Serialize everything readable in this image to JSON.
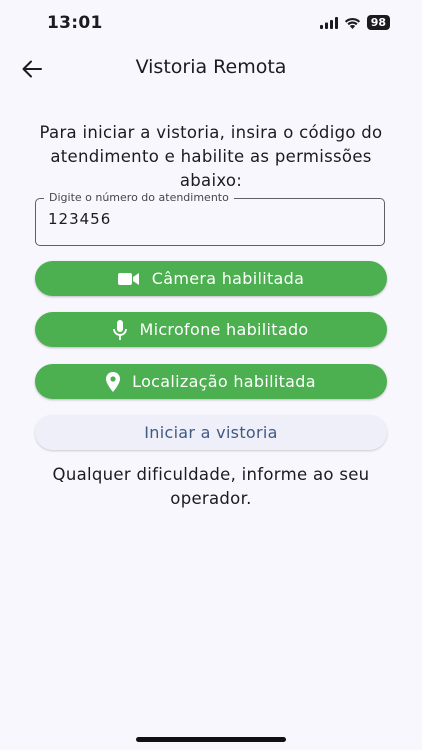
{
  "status_bar": {
    "time": "13:01",
    "battery": "98"
  },
  "app_bar": {
    "title": "Vistoria Remota"
  },
  "intro_text": "Para iniciar a vistoria, insira o código do atendimento e habilite as permissões abaixo:",
  "attendance_field": {
    "label": "Digite o número do atendimento",
    "value": "123456"
  },
  "permissions": {
    "camera": "Câmera habilitada",
    "microphone": "Microfone habilitado",
    "location": "Localização habilitada"
  },
  "start_button": "Iniciar a vistoria",
  "help_text": "Qualquer dificuldade, informe ao seu operador.",
  "colors": {
    "primary_green": "#4caf50",
    "background": "#f8f7fd",
    "start_button_text": "#3f5a85"
  }
}
